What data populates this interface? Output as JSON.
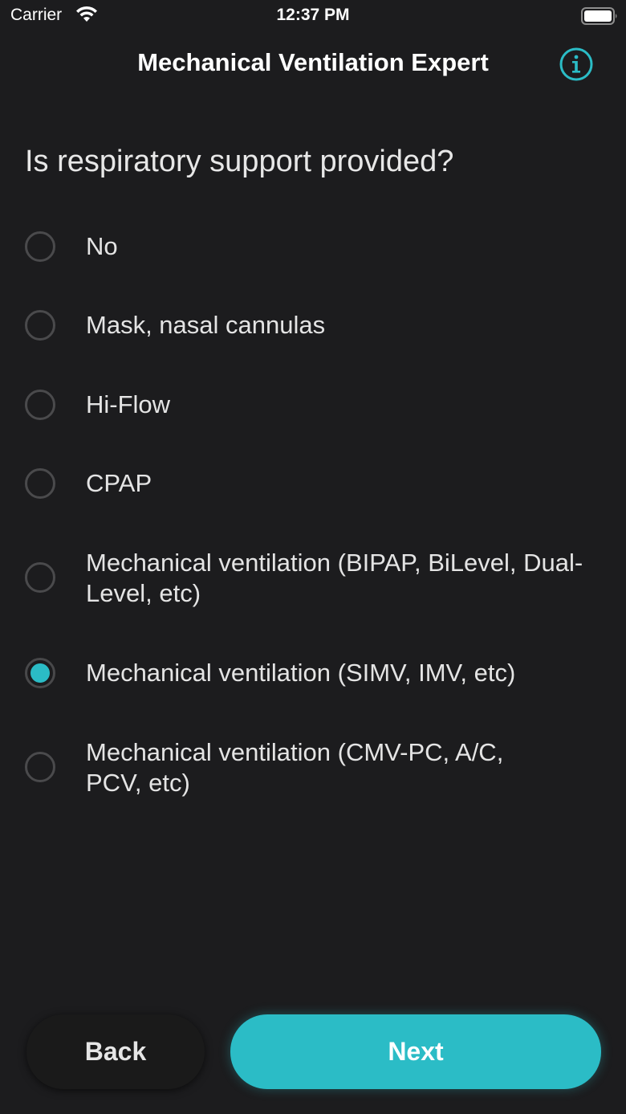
{
  "status_bar": {
    "carrier": "Carrier",
    "time": "12:37 PM",
    "wifi_icon": "wifi-icon",
    "battery_icon": "battery-icon"
  },
  "nav": {
    "title": "Mechanical Ventilation Expert",
    "info_icon": "info-icon"
  },
  "question": "Is respiratory support provided?",
  "options": [
    {
      "label": "No",
      "selected": false
    },
    {
      "label": "Mask, nasal cannulas",
      "selected": false
    },
    {
      "label": "Hi-Flow",
      "selected": false
    },
    {
      "label": "CPAP",
      "selected": false
    },
    {
      "label": "Mechanical ventilation (BIPAP, BiLevel, Dual-Level, etc)",
      "selected": false
    },
    {
      "label": "Mechanical ventilation (SIMV, IMV, etc)",
      "selected": true
    },
    {
      "label": "Mechanical ventilation (CMV-PC, A/C, PCV, etc)",
      "selected": false
    }
  ],
  "buttons": {
    "back": "Back",
    "next": "Next"
  },
  "colors": {
    "accent": "#2bbcc6",
    "background": "#1c1c1e"
  }
}
